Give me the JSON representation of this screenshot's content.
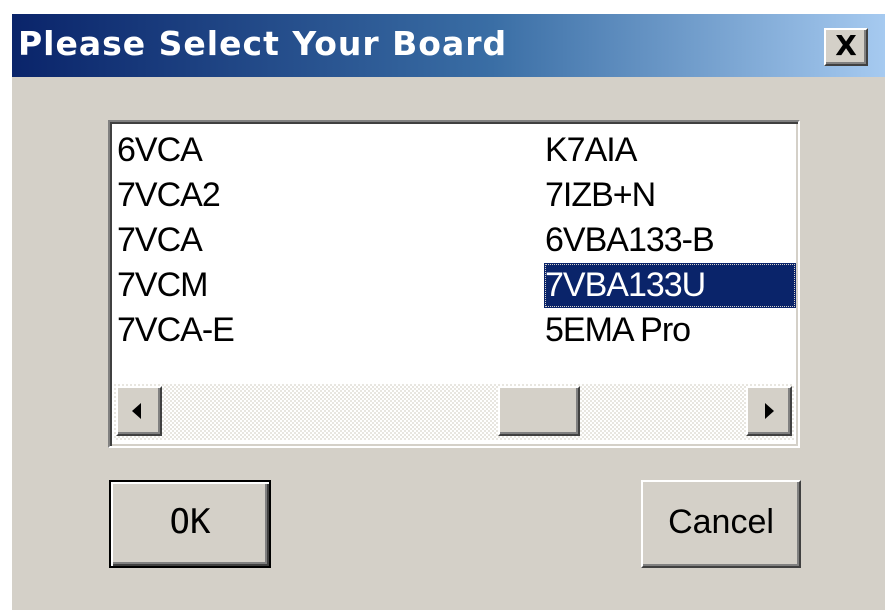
{
  "window": {
    "title": "Please Select Your Board",
    "close_label": "X"
  },
  "board_list": {
    "left_column": [
      "6VCA",
      "7VCA2",
      "7VCA",
      "7VCM",
      "7VCA-E"
    ],
    "right_column": [
      "K7AIA",
      "7IZB+N",
      "6VBA133-B",
      "7VBA133U",
      "5EMA Pro"
    ],
    "selected": "7VBA133U"
  },
  "scrollbar": {
    "left_arrow_icon": "arrow-left-icon",
    "right_arrow_icon": "arrow-right-icon"
  },
  "buttons": {
    "ok_label": "OK",
    "cancel_label": "Cancel"
  },
  "colors": {
    "title_gradient_start": "#0a246a",
    "title_gradient_end": "#a6caf0",
    "selection_bg": "#0a246a",
    "dialog_bg": "#d4d0c8"
  }
}
